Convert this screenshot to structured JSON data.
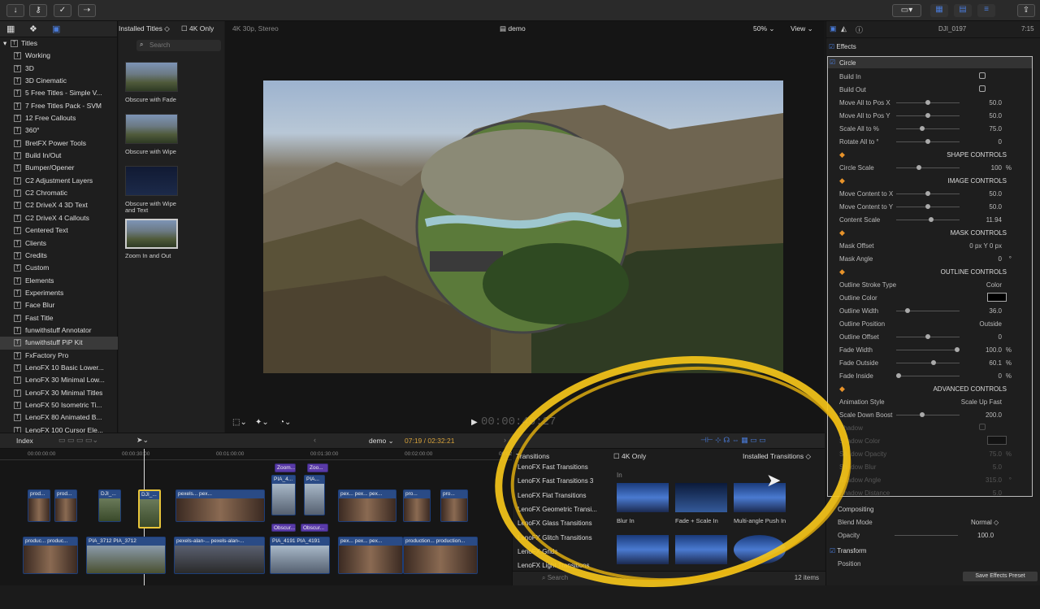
{
  "toolbar": {
    "icons": [
      "import-icon",
      "key-icon",
      "check-icon",
      "export-icon"
    ]
  },
  "sidebar": {
    "root": "Titles",
    "items": [
      "Working",
      "3D",
      "3D Cinematic",
      "5 Free Titles - Simple V...",
      "7 Free Titles Pack - SVM",
      "12 Free Callouts",
      "360°",
      "BretFX Power Tools",
      "Build In/Out",
      "Bumper/Opener",
      "C2 Adjustment Layers",
      "C2 Chromatic",
      "C2 DriveX 4 3D Text",
      "C2 DriveX 4 Callouts",
      "Centered Text",
      "Clients",
      "Credits",
      "Custom",
      "Elements",
      "Experiments",
      "Face Blur",
      "Fast Title",
      "funwithstuff Annotator",
      "funwithstuff PiP Kit",
      "FxFactory Pro",
      "LenoFX 10 Basic Lower...",
      "LenoFX 30 Minimal Low...",
      "LenoFX 30 Minimal Titles",
      "LenoFX 50 Isometric Ti...",
      "LenoFX 80 Animated B...",
      "LenoFX 100 Cursor Ele..."
    ],
    "selected_index": 23
  },
  "browser": {
    "filter": "Installed Titles",
    "only4k": "4K Only",
    "search_placeholder": "Search",
    "items": [
      "Obscure with Fade",
      "Obscure with Wipe",
      "Obscure with Wipe and Text",
      "Zoom In and Out"
    ]
  },
  "viewer": {
    "format": "4K 30p, Stereo",
    "project": "demo",
    "zoom": "50%",
    "view": "View",
    "timecode": "00:00:40:27"
  },
  "inspector": {
    "clip": "DJI_0197",
    "duration": "7:15",
    "effects": "Effects",
    "effect_name": "Circle",
    "rows": [
      {
        "label": "Build In",
        "type": "check"
      },
      {
        "label": "Build Out",
        "type": "check"
      },
      {
        "label": "Move All to Pos X",
        "value": "50.0",
        "knob": 0.5
      },
      {
        "label": "Move All to Pos Y",
        "value": "50.0",
        "knob": 0.5
      },
      {
        "label": "Scale All to %",
        "value": "75.0",
        "knob": 0.4
      },
      {
        "label": "Rotate All to °",
        "value": "0",
        "knob": 0.5
      },
      {
        "label": "SHAPE CONTROLS",
        "type": "section"
      },
      {
        "label": "Circle Scale",
        "value": "100",
        "unit": "%",
        "knob": 0.35
      },
      {
        "label": "IMAGE CONTROLS",
        "type": "section"
      },
      {
        "label": "Move Content to X",
        "value": "50.0",
        "knob": 0.5
      },
      {
        "label": "Move Content to Y",
        "value": "50.0",
        "knob": 0.5
      },
      {
        "label": "Content Scale",
        "value": "11.94",
        "knob": 0.55
      },
      {
        "label": "MASK CONTROLS",
        "type": "section"
      },
      {
        "label": "Mask Offset",
        "value": "0 px  Y   0 px"
      },
      {
        "label": "Mask Angle",
        "value": "0",
        "unit": "°"
      },
      {
        "label": "OUTLINE CONTROLS",
        "type": "section"
      },
      {
        "label": "Outline Stroke Type",
        "value": "Color"
      },
      {
        "label": "Outline Color",
        "type": "color"
      },
      {
        "label": "Outline Width",
        "value": "36.0",
        "knob": 0.15
      },
      {
        "label": "Outline Position",
        "value": "Outside"
      },
      {
        "label": "Outline Offset",
        "value": "0",
        "knob": 0.5
      },
      {
        "label": "Fade Width",
        "value": "100.0",
        "unit": "%",
        "knob": 1.0
      },
      {
        "label": "Fade Outside",
        "value": "60.1",
        "unit": "%",
        "knob": 0.6
      },
      {
        "label": "Fade Inside",
        "value": "0",
        "unit": "%",
        "knob": 0.0
      },
      {
        "label": "ADVANCED CONTROLS",
        "type": "section"
      },
      {
        "label": "Animation Style",
        "value": "Scale Up Fast"
      },
      {
        "label": "Scale Down Boost",
        "value": "200.0",
        "knob": 0.4
      },
      {
        "label": "Shadow",
        "type": "check"
      },
      {
        "label": "Shadow Color",
        "type": "color"
      },
      {
        "label": "Shadow Opacity",
        "value": "75.0",
        "unit": "%"
      },
      {
        "label": "Shadow Blur",
        "value": "5.0"
      },
      {
        "label": "Shadow Angle",
        "value": "315.0",
        "unit": "°"
      },
      {
        "label": "Shadow Distance",
        "value": "5.0"
      }
    ],
    "compositing": "Compositing",
    "blend_mode_label": "Blend Mode",
    "blend_mode": "Normal",
    "opacity_label": "Opacity",
    "opacity": "100.0",
    "transform": "Transform",
    "position_label": "Position",
    "save_preset": "Save Effects Preset"
  },
  "timeline": {
    "index": "Index",
    "project": "demo",
    "timecode": "07:19 / 02:32:21",
    "ruler": [
      "00:00:00:00",
      "00:00:30:00",
      "00:01:00:00",
      "00:01:30:00",
      "00:02:00:00",
      "00:02:30:00"
    ]
  },
  "transitions": {
    "title": "Transitions",
    "only4k": "4K Only",
    "filter": "Installed Transitions",
    "list": [
      "LenoFX Fast Transitions",
      "LenoFX Fast Transitions 3",
      "LenoFX Flat Transitions",
      "LenoFX Geometric Transi...",
      "LenoFX Glass Transitions",
      "LenoFX Glitch Transitions",
      "LenoFX Grids",
      "LenoFX Light Transitions"
    ],
    "group": "In",
    "items": [
      "Blur In",
      "Fade + Scale In",
      "Multi-angle Push In"
    ],
    "count": "12 items",
    "search": "Search"
  }
}
